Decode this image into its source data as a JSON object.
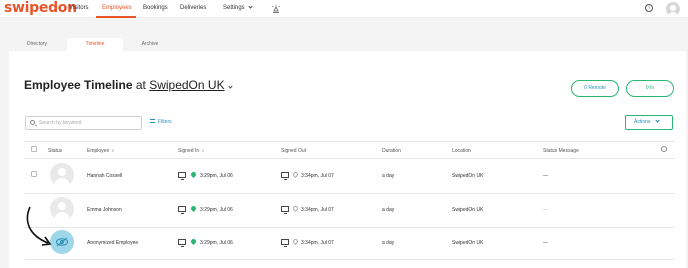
{
  "app": {
    "logo": "swipedon"
  },
  "nav": {
    "items": [
      {
        "label": "Visitors",
        "active": false
      },
      {
        "label": "Employees",
        "active": true
      },
      {
        "label": "Bookings",
        "active": false
      },
      {
        "label": "Deliveries",
        "active": false
      },
      {
        "label": "Settings",
        "active": false
      }
    ],
    "info_icon": "i"
  },
  "tabs": [
    {
      "label": "Directory",
      "active": false
    },
    {
      "label": "Timeline",
      "active": true
    },
    {
      "label": "Archive",
      "active": false
    }
  ],
  "header": {
    "title": "Employee Timeline",
    "at": "at",
    "location": "SwipedOn UK",
    "remote_label": "0 Remote",
    "in_label": "0 In"
  },
  "toolbar": {
    "search_placeholder": "Search by keyword",
    "filters_label": "Filters",
    "actions_label": "Actions"
  },
  "table": {
    "columns": [
      "Status",
      "Employee",
      "Signed In",
      "Signed Out",
      "Duration",
      "Location",
      "Status Message"
    ],
    "rows": [
      {
        "employee": "Hannah Cossell",
        "signed_in": "3:29pm, Jul 06",
        "signed_out": "3:34pm, Jul 07",
        "duration": "a day",
        "location": "SwipedOn UK",
        "status_message": "—",
        "anonymized": false
      },
      {
        "employee": "Emma Johnson",
        "signed_in": "3:29pm, Jul 06",
        "signed_out": "3:34pm, Jul 07",
        "duration": "a day",
        "location": "SwipedOn UK",
        "status_message": "—",
        "anonymized": false
      },
      {
        "employee": "Anonymized Employee",
        "signed_in": "3:29pm, Jul 06",
        "signed_out": "3:34pm, Jul 07",
        "duration": "a day",
        "location": "SwipedOn UK",
        "status_message": "—",
        "anonymized": true
      }
    ]
  },
  "colors": {
    "brand": "#e8552b",
    "green": "#2bb673",
    "blue": "#2b8fb6"
  }
}
